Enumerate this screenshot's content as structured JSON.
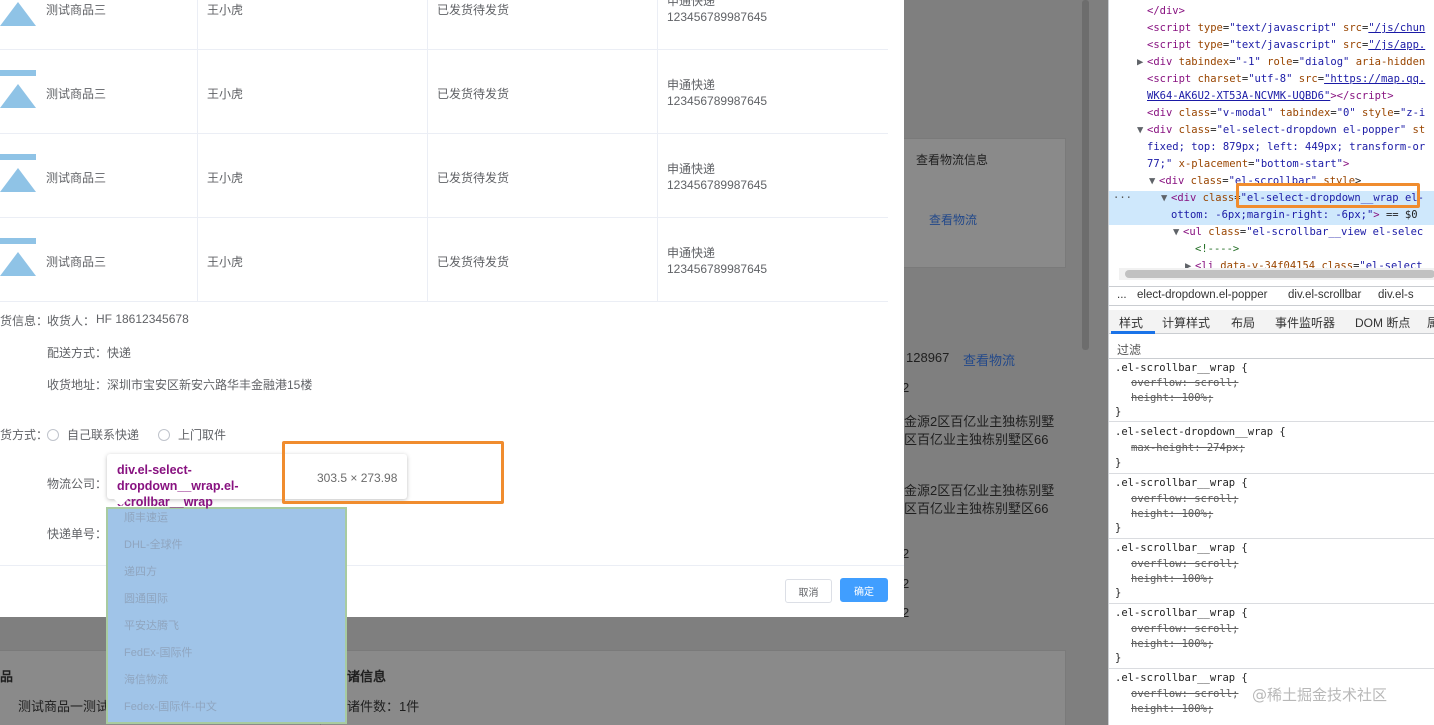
{
  "background": {
    "logistics_header": "查看物流信息",
    "view_logistics": "查看物流",
    "tracking_partial": "128967",
    "tracking_link": "查看物流",
    "digit2_a": "2",
    "addr_line1": "金源2区百亿业主独栋别墅",
    "addr_line2": "区百亿业主独栋别墅区66",
    "addr_line3": "金源2区百亿业主独栋别墅",
    "addr_line4": "区百亿业主独栋别墅区66",
    "digit2_b": "2",
    "digit2_c": "2",
    "digit2_d": "2",
    "bottom_left_title": "品",
    "bottom_product": "测试商品一测试",
    "logistic_info_title": "诸信息",
    "parts_count": "诸件数：1件"
  },
  "dialog": {
    "rows": [
      {
        "product": "测试商品三",
        "receiver": "王小虎",
        "status": "已发货待发货",
        "courier": "申通快递",
        "tracking": "123456789987645"
      },
      {
        "product": "测试商品三",
        "receiver": "王小虎",
        "status": "已发货待发货",
        "courier": "申通快递",
        "tracking": "123456789987645"
      },
      {
        "product": "测试商品三",
        "receiver": "王小虎",
        "status": "已发货待发货",
        "courier": "申通快递",
        "tracking": "123456789987645"
      },
      {
        "product": "测试商品三",
        "receiver": "王小虎",
        "status": "已发货待发货",
        "courier": "申通快递",
        "tracking": "123456789987645"
      }
    ],
    "receiver_info_label": "货信息：",
    "receiver_label": "收货人：",
    "receiver_value": "HF  18612345678",
    "delivery_label": "配送方式：",
    "delivery_value": "快递",
    "address_label": "收货地址：",
    "address_value": "深圳市宝安区新安六路华丰金融港15楼",
    "ship_method_label": "货方式：",
    "radio_self": "自己联系快递",
    "radio_pickup": "上门取件",
    "company_label": "物流公司：",
    "tracking_label": "快递单号：",
    "cancel": "取消",
    "ok": "确定"
  },
  "dropdown": {
    "items": [
      "顺丰速运",
      "DHL-全球件",
      "递四方",
      "圆通国际",
      "平安达腾飞",
      "FedEx-国际件",
      "海信物流",
      "Fedex-国际件-中文"
    ],
    "tooltip_tag": "div.el-select-dropdown__wrap.el-scrollbar__wrap",
    "tooltip_size": "303.5 × 273.98"
  },
  "devtools": {
    "crumbs": [
      "...",
      "elect-dropdown.el-popper",
      "div.el-scrollbar",
      "div.el-s"
    ],
    "tabs": [
      "样式",
      "计算样式",
      "布局",
      "事件监听器",
      "DOM 断点",
      "属"
    ],
    "filter": "过滤",
    "rules": [
      {
        "selector": ".el-scrollbar__wrap {",
        "props": [
          "overflow: scroll;",
          "height: 100%;"
        ]
      },
      {
        "selector": ".el-select-dropdown__wrap {",
        "props": [
          "max-height: 274px;"
        ]
      },
      {
        "selector": ".el-scrollbar__wrap {",
        "props": [
          "overflow: scroll;",
          "height: 100%;"
        ]
      },
      {
        "selector": ".el-scrollbar__wrap {",
        "props": [
          "overflow: scroll;",
          "height: 100%;"
        ]
      },
      {
        "selector": ".el-scrollbar__wrap {",
        "props": [
          "overflow: scroll;",
          "height: 100%;"
        ]
      },
      {
        "selector": ".el-scrollbar__wrap {",
        "props": [
          "overflow: scroll;",
          "height: 100%;"
        ]
      }
    ],
    "closing_brace": "}",
    "watermark": "@稀土掘金技术社区"
  }
}
